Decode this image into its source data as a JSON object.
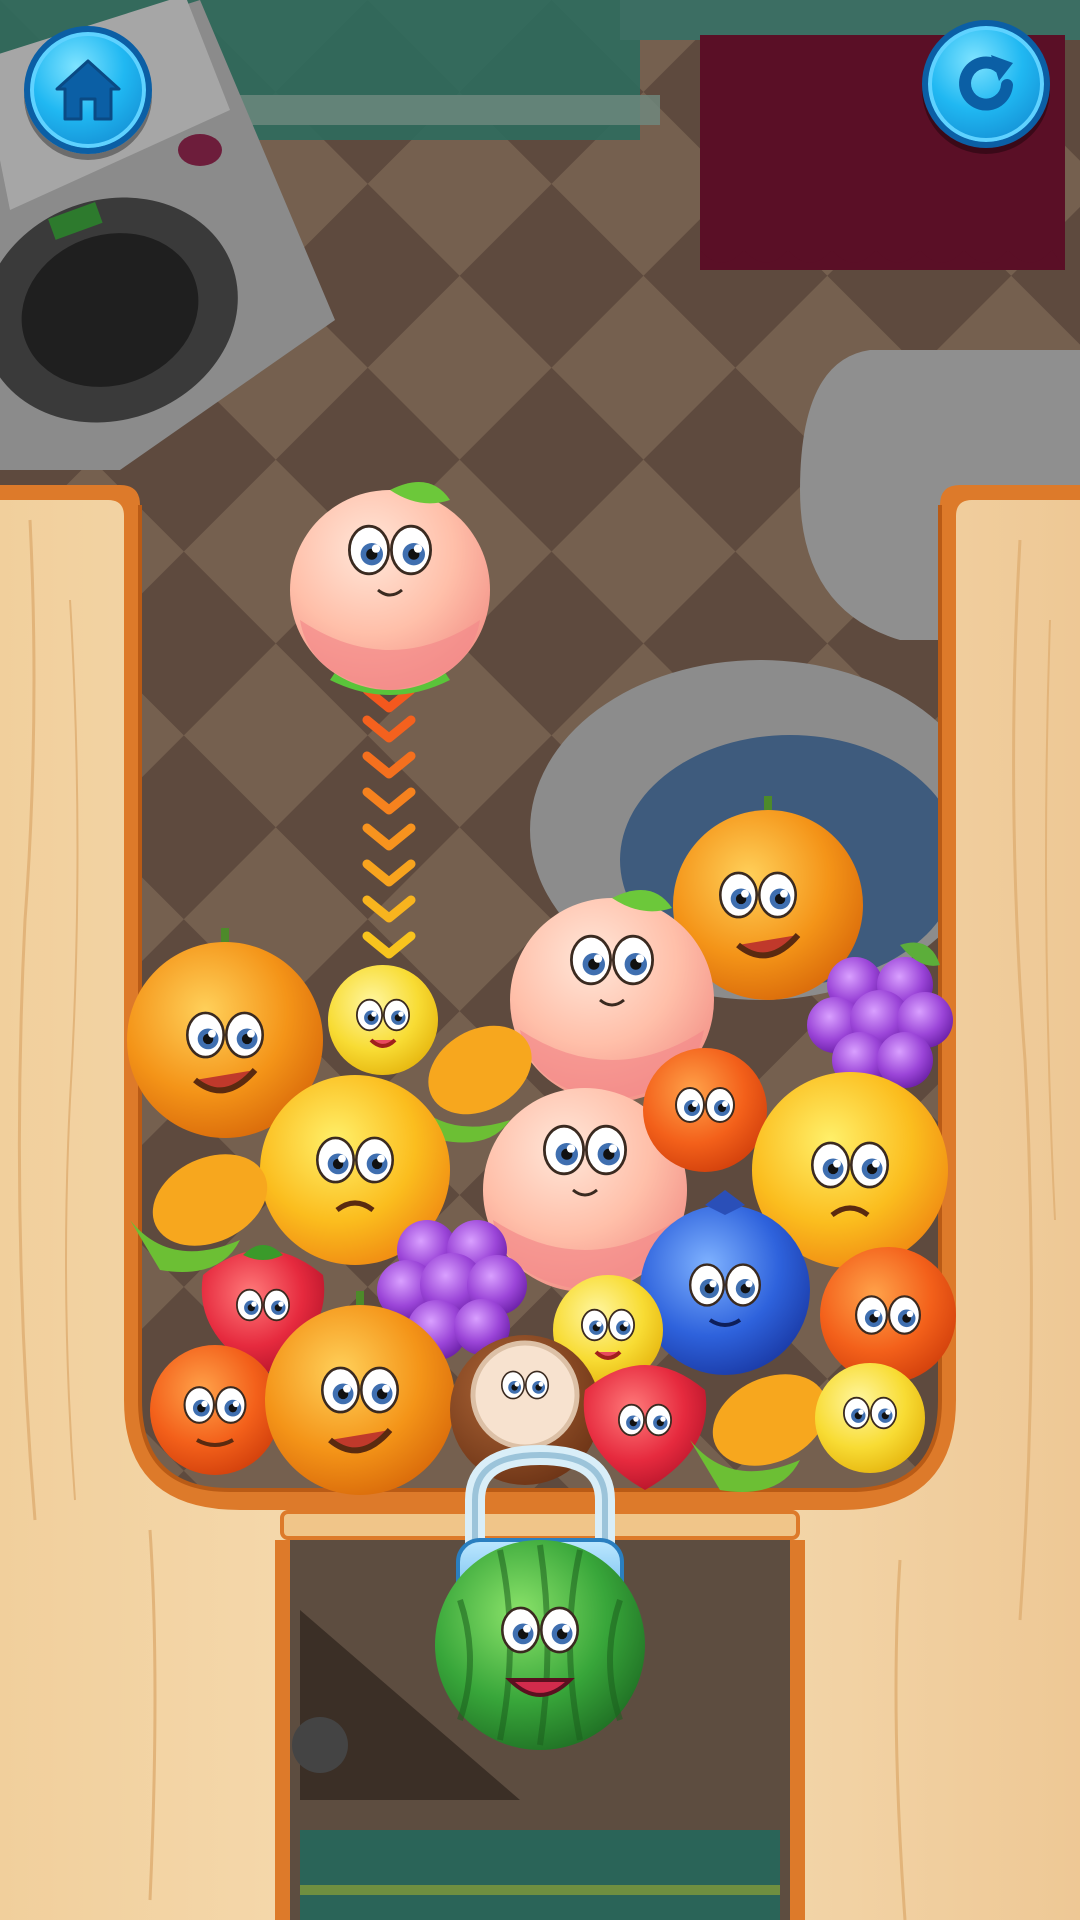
{
  "hud": {
    "home_icon": "home-icon",
    "restart_icon": "restart-icon"
  },
  "next_fruit": {
    "type": "peach",
    "icon": "peach-icon"
  },
  "locked_fruit": {
    "type": "watermelon",
    "icon": "watermelon-icon",
    "lock_icon": "padlock-icon",
    "locked": true
  },
  "colors": {
    "orange": "#f08a1a",
    "peach": "#ffb7a6",
    "grape": "#8a39c8",
    "lemon": "#f7d835",
    "corn": "#f59b1a",
    "strawberry": "#e3213a",
    "tangerine": "#f45a16",
    "blueberry": "#2b5ed8",
    "coconut": "#8a4a26",
    "watermelon": "#36a23a",
    "wood": "#f3d5a6",
    "wood_edge": "#dd7a2a",
    "button": "#1fb4f0"
  },
  "container_fruits": [
    "orange",
    "lemon",
    "peach",
    "orange",
    "grape",
    "corn",
    "orange",
    "corn",
    "peach",
    "tangerine",
    "orange",
    "corn",
    "strawberry",
    "grape",
    "blueberry",
    "lemon",
    "tangerine",
    "tangerine",
    "orange",
    "coconut",
    "strawberry",
    "corn",
    "lemon"
  ]
}
